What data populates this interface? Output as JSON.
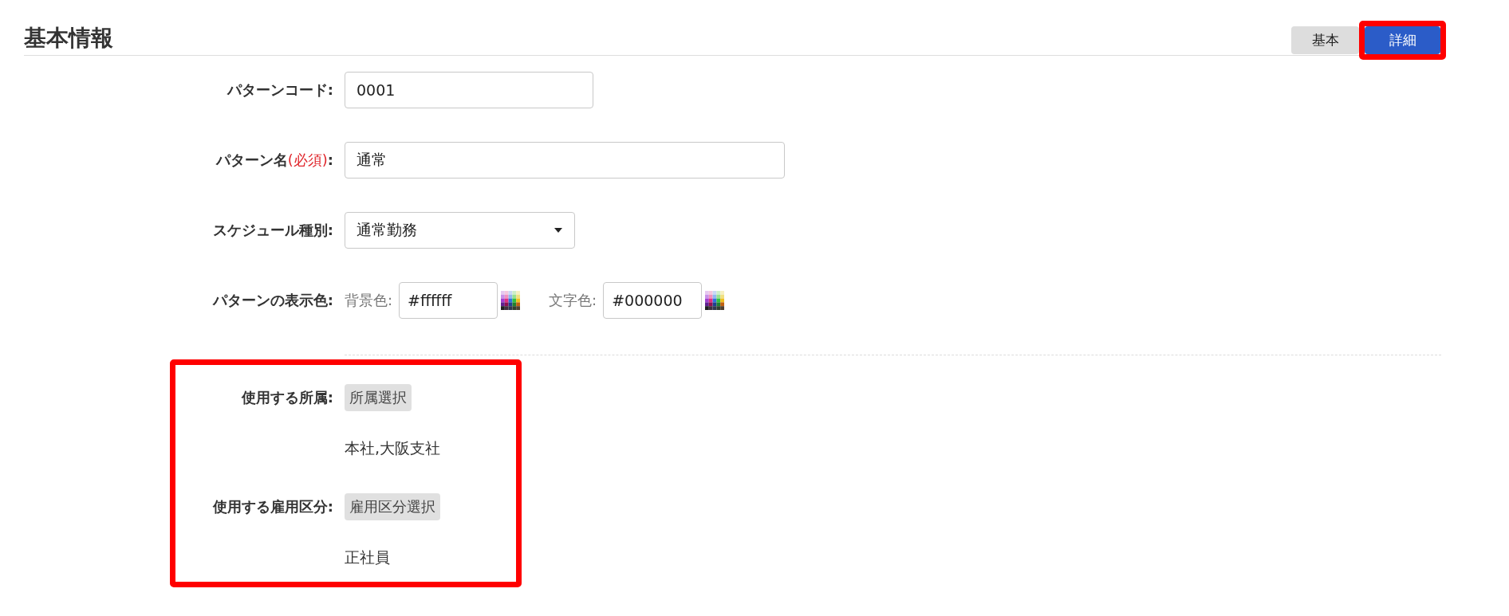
{
  "header": {
    "title": "基本情報",
    "view_buttons": [
      {
        "label": "基本",
        "selected": false,
        "highlighted": false
      },
      {
        "label": "詳細",
        "selected": true,
        "highlighted": true
      }
    ]
  },
  "form": {
    "rows": [
      {
        "kind": "text",
        "label": "パターンコード:",
        "value": "0001"
      },
      {
        "kind": "text",
        "label": "パターン名",
        "required_note": "(必須)",
        "label_end": ":",
        "value": "通常"
      },
      {
        "kind": "select",
        "label": "スケジュール種別:",
        "value": "通常勤務"
      },
      {
        "kind": "colors",
        "label": "パターンの表示色:",
        "colors": [
          {
            "label": "背景色:",
            "value": "#ffffff"
          },
          {
            "label": "文字色:",
            "value": "#000000"
          }
        ]
      }
    ]
  },
  "usage": {
    "highlighted": true,
    "rows": [
      {
        "kind": "picker",
        "label": "使用する所属:",
        "button": "所属選択",
        "selection": "本社,大阪支社"
      },
      {
        "kind": "picker",
        "label": "使用する雇用区分:",
        "button": "雇用区分選択",
        "selection": "正社員"
      }
    ]
  }
}
